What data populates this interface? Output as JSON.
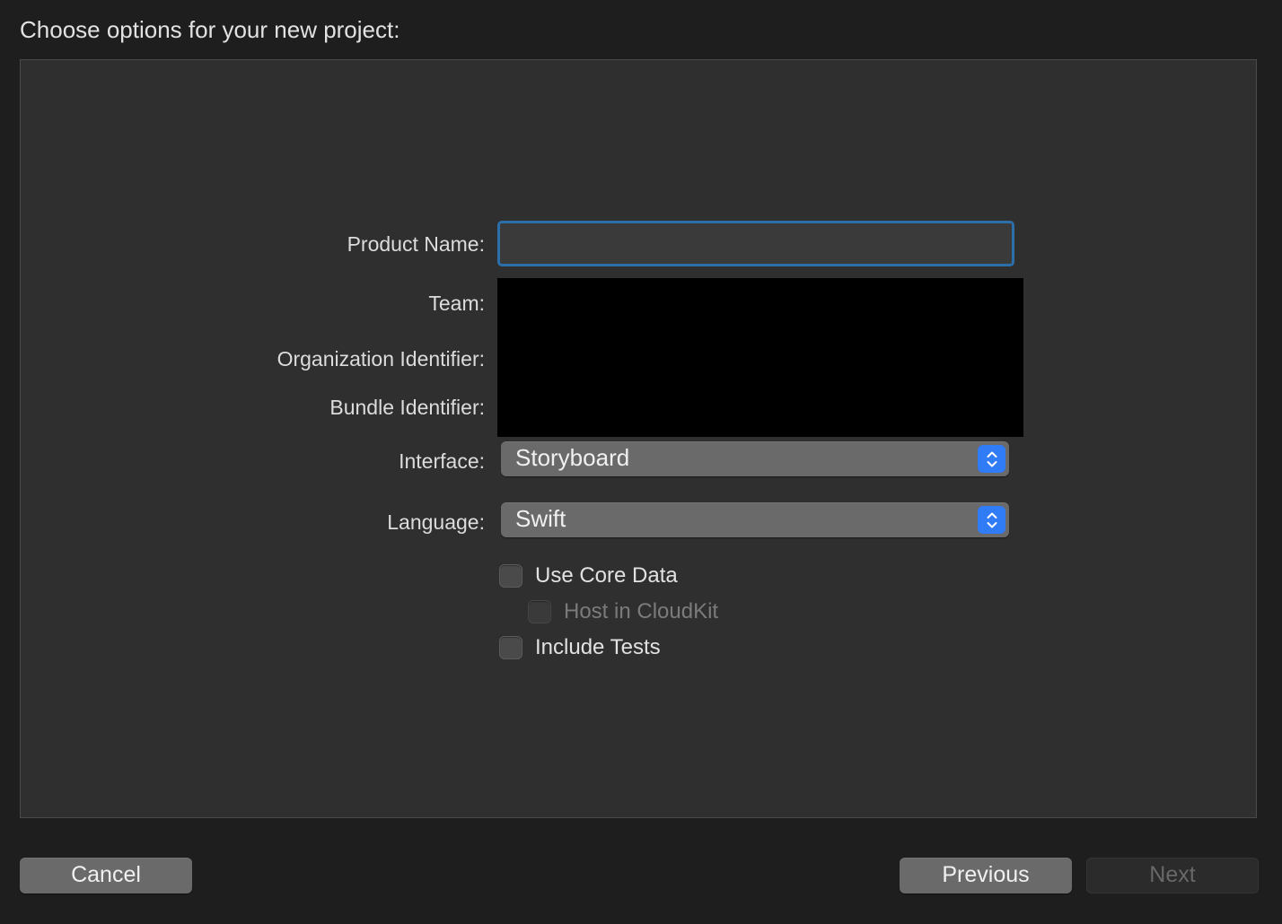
{
  "dialog": {
    "title": "Choose options for your new project:"
  },
  "form": {
    "product_name": {
      "label": "Product Name:",
      "value": "",
      "placeholder": ""
    },
    "team": {
      "label": "Team:"
    },
    "organization_identifier": {
      "label": "Organization Identifier:"
    },
    "bundle_identifier": {
      "label": "Bundle Identifier:"
    },
    "interface": {
      "label": "Interface:",
      "selected": "Storyboard"
    },
    "language": {
      "label": "Language:",
      "selected": "Swift"
    },
    "checkboxes": {
      "use_core_data": {
        "label": "Use Core Data",
        "checked": false,
        "enabled": true
      },
      "host_in_cloudkit": {
        "label": "Host in CloudKit",
        "checked": false,
        "enabled": false
      },
      "include_tests": {
        "label": "Include Tests",
        "checked": false,
        "enabled": true
      }
    }
  },
  "buttons": {
    "cancel": "Cancel",
    "previous": "Previous",
    "next": "Next",
    "next_enabled": false
  },
  "colors": {
    "accent": "#2f7cf6",
    "focus_ring": "#2c6ea8",
    "panel_background": "#2f2f30",
    "window_background": "#1e1e1f"
  },
  "icons": {
    "popup_stepper": "chevron-up-down-icon"
  }
}
